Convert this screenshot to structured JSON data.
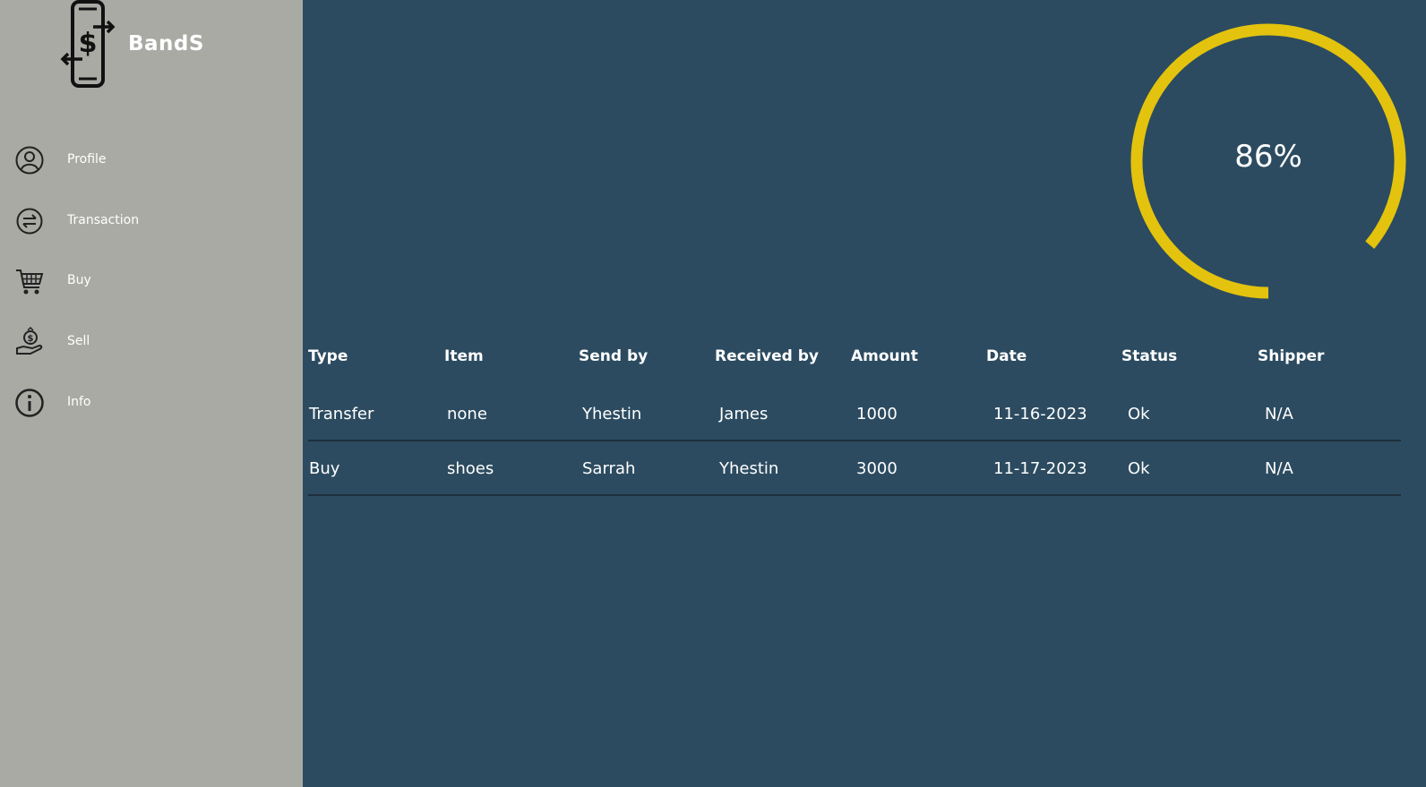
{
  "app": {
    "brand": "BandS"
  },
  "sidebar": {
    "items": [
      {
        "label": "Profile",
        "icon": "profile-icon"
      },
      {
        "label": "Transaction",
        "icon": "transaction-icon"
      },
      {
        "label": "Buy",
        "icon": "cart-icon"
      },
      {
        "label": "Sell",
        "icon": "money-hand-icon"
      },
      {
        "label": "Info",
        "icon": "info-icon"
      }
    ]
  },
  "gauge": {
    "value": 0.86,
    "label": "86%",
    "color": "#e3c30d"
  },
  "table": {
    "headers": [
      "Type",
      "Item",
      "Send by",
      "Received by",
      "Amount",
      "Date",
      "Status",
      "Shipper"
    ],
    "rows": [
      [
        "Transfer",
        "none",
        "Yhestin",
        "James",
        "1000",
        "11-16-2023",
        "Ok",
        "N/A"
      ],
      [
        "Buy",
        "shoes",
        "Sarrah",
        "Yhestin",
        "3000",
        "11-17-2023",
        "Ok",
        "N/A"
      ]
    ]
  },
  "colors": {
    "sidebar": "#a9aaa4",
    "main": "#2c4b60",
    "accent": "#e3c30d"
  }
}
